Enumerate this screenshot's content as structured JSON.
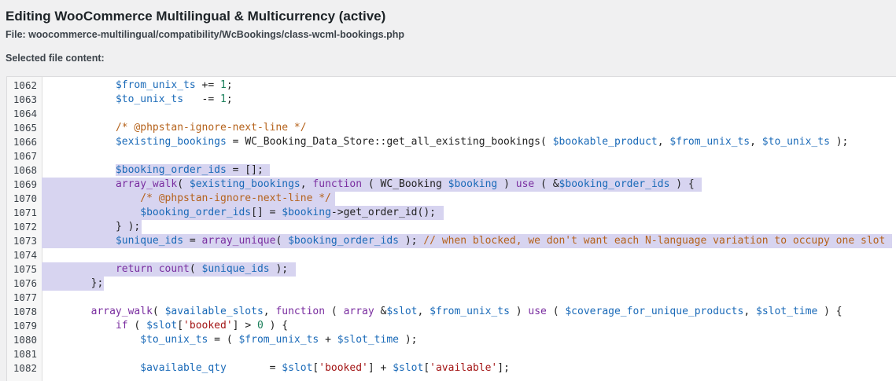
{
  "header": {
    "title": "Editing WooCommerce Multilingual & Multicurrency (active)",
    "file": "File: woocommerce-multilingual/compatibility/WcBookings/class-wcml-bookings.php",
    "selected_label": "Selected file content:"
  },
  "colors": {
    "selection": "#d7d4f0",
    "variable": "#1a6ab8",
    "keyword": "#7a2ea0",
    "comment": "#b5621b",
    "string": "#a31515",
    "number": "#1a7f5a",
    "warning_underline": "#e0761a",
    "error_underline": "#d12c2c"
  },
  "editor": {
    "lines": [
      {
        "num": "1062",
        "text": "            $from_unix_ts += 1;"
      },
      {
        "num": "1063",
        "text": "            $to_unix_ts   -= 1;"
      },
      {
        "num": "1064",
        "text": ""
      },
      {
        "num": "1065",
        "text": "            /* @phpstan-ignore-next-line */"
      },
      {
        "num": "1066",
        "text": "            $existing_bookings = WC_Booking_Data_Store::get_all_existing_bookings( $bookable_product, $from_unix_ts, $to_unix_ts );"
      },
      {
        "num": "1067",
        "text": ""
      },
      {
        "num": "1068",
        "text": "            $booking_order_ids = [];"
      },
      {
        "num": "1069",
        "text": "            array_walk( $existing_bookings, function ( WC_Booking $booking ) use ( &$booking_order_ids ) {"
      },
      {
        "num": "1070",
        "text": "                /* @phpstan-ignore-next-line */"
      },
      {
        "num": "1071",
        "text": "                $booking_order_ids[] = $booking->get_order_id();"
      },
      {
        "num": "1072",
        "text": "            } );"
      },
      {
        "num": "1073",
        "text": "            $unique_ids = array_unique( $booking_order_ids ); // when blocked, we don't want each N-language variation to occupy one slot"
      },
      {
        "num": "1074",
        "text": ""
      },
      {
        "num": "1075",
        "text": "            return count( $unique_ids );"
      },
      {
        "num": "1076",
        "text": "        };"
      },
      {
        "num": "1077",
        "text": ""
      },
      {
        "num": "1078",
        "text": "        array_walk( $available_slots, function ( array &$slot, $from_unix_ts ) use ( $coverage_for_unique_products, $slot_time ) {"
      },
      {
        "num": "1079",
        "text": "            if ( $slot['booked'] > 0 ) {"
      },
      {
        "num": "1080",
        "text": "                $to_unix_ts = ( $from_unix_ts + $slot_time );"
      },
      {
        "num": "1081",
        "text": ""
      },
      {
        "num": "1082",
        "text": "                $available_qty       = $slot['booked'] + $slot['available'];"
      }
    ]
  }
}
